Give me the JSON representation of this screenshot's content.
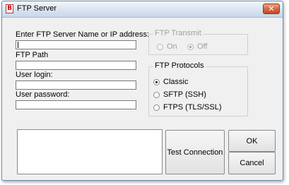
{
  "window": {
    "title": "FTP Server",
    "icon": "ftp-app-icon",
    "close_glyph": "✕"
  },
  "fields": {
    "server_label": "Enter FTP Server Name or IP address:",
    "server_value": "",
    "path_label": "FTP Path",
    "path_value": "",
    "login_label": "User login:",
    "login_value": "",
    "password_label": "User password:",
    "password_value": ""
  },
  "transmit": {
    "title": "FTP Transmit",
    "options": [
      {
        "label": "On",
        "checked": false
      },
      {
        "label": "Off",
        "checked": true
      }
    ]
  },
  "protocols": {
    "title": "FTP Protocols",
    "options": [
      {
        "label": "Classic",
        "checked": true
      },
      {
        "label": "SFTP (SSH)",
        "checked": false
      },
      {
        "label": "FTPS (TLS/SSL)",
        "checked": false
      }
    ]
  },
  "buttons": {
    "test": "Test Connection",
    "ok": "OK",
    "cancel": "Cancel"
  }
}
